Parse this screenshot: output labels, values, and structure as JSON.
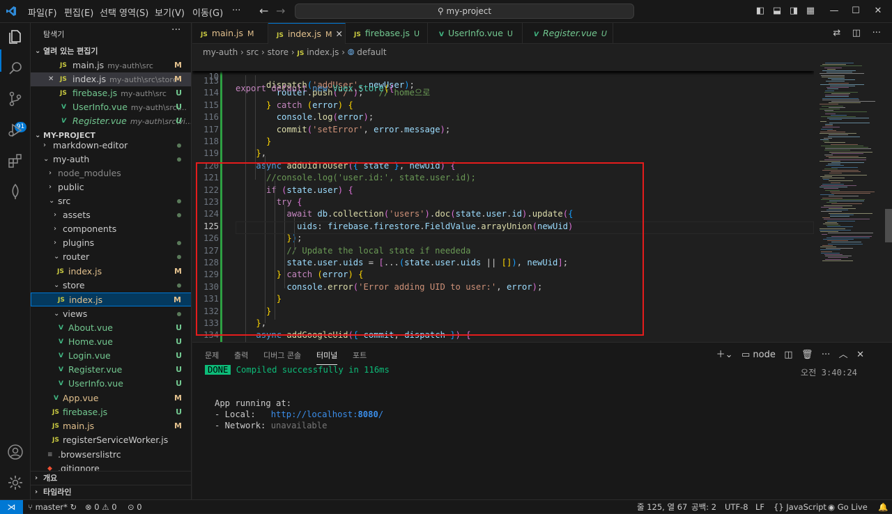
{
  "titlebar": {
    "menu": [
      "파일(F)",
      "편집(E)",
      "선택 영역(S)",
      "보기(V)",
      "이동(G)",
      "···"
    ],
    "search": "my-project"
  },
  "activity": {
    "scm_badge": "91"
  },
  "sidebar": {
    "title": "탐색기",
    "more": "···",
    "open_editors": {
      "header": "열려 있는 편집기",
      "items": [
        {
          "icon": "JS",
          "name": "main.js",
          "path": "my-auth\\src",
          "status": "M"
        },
        {
          "icon": "JS",
          "name": "index.js",
          "path": "my-auth\\src\\store",
          "status": "M"
        },
        {
          "icon": "JS",
          "name": "firebase.js",
          "path": "my-auth\\src",
          "status": "U"
        },
        {
          "icon": "V",
          "name": "UserInfo.vue",
          "path": "my-auth\\src\\...",
          "status": "U"
        },
        {
          "icon": "V",
          "name": "Register.vue",
          "path": "my-auth\\src\\vi...",
          "status": "U"
        }
      ]
    },
    "project": {
      "header": "MY-PROJECT",
      "tree": [
        {
          "name": "markdown-editor",
          "chev": "›"
        },
        {
          "name": "my-auth",
          "chev": "⌄"
        },
        {
          "name": "node_modules",
          "chev": "›"
        },
        {
          "name": "public",
          "chev": "›"
        },
        {
          "name": "src",
          "chev": "⌄"
        },
        {
          "name": "assets",
          "chev": "›"
        },
        {
          "name": "components",
          "chev": "›"
        },
        {
          "name": "plugins",
          "chev": "›"
        },
        {
          "name": "router",
          "chev": "⌄"
        },
        {
          "name": "index.js",
          "icon": "JS",
          "status": "M"
        },
        {
          "name": "store",
          "chev": "⌄"
        },
        {
          "name": "index.js",
          "icon": "JS",
          "status": "M"
        },
        {
          "name": "views",
          "chev": "⌄"
        },
        {
          "name": "About.vue",
          "icon": "V",
          "status": "U"
        },
        {
          "name": "Home.vue",
          "icon": "V",
          "status": "U"
        },
        {
          "name": "Login.vue",
          "icon": "V",
          "status": "U"
        },
        {
          "name": "Register.vue",
          "icon": "V",
          "status": "U"
        },
        {
          "name": "UserInfo.vue",
          "icon": "V",
          "status": "U"
        },
        {
          "name": "App.vue",
          "icon": "V",
          "status": "M"
        },
        {
          "name": "firebase.js",
          "icon": "JS",
          "status": "U"
        },
        {
          "name": "main.js",
          "icon": "JS",
          "status": "M"
        },
        {
          "name": "registerServiceWorker.js",
          "icon": "JS"
        },
        {
          "name": ".browserslistrc",
          "icon": "≡"
        },
        {
          "name": ".gitignore",
          "icon": "◆"
        }
      ]
    },
    "outline": "개요",
    "timeline": "타임라인"
  },
  "tabs": [
    {
      "icon": "JS",
      "label": "main.js",
      "status": "M"
    },
    {
      "icon": "JS",
      "label": "index.js",
      "status": "M"
    },
    {
      "icon": "JS",
      "label": "firebase.js",
      "status": "U"
    },
    {
      "icon": "V",
      "label": "UserInfo.vue",
      "status": "U"
    },
    {
      "icon": "V",
      "label": "Register.vue",
      "status": "U"
    }
  ],
  "breadcrumb": {
    "parts": [
      "my-auth",
      "src",
      "store"
    ],
    "file": "index.js",
    "symbol": "default",
    "sep": "›"
  },
  "code": {
    "sticky_no": "10",
    "sticky": "export default new Vuex.Store({",
    "partial_top": "      dispatch('addUser', newUser);",
    "line_numbers": [
      "113",
      "114",
      "115",
      "116",
      "117",
      "118",
      "119",
      "120",
      "121",
      "122",
      "123",
      "124",
      "125",
      "126",
      "127",
      "128",
      "129",
      "130",
      "131",
      "132",
      "133",
      "134"
    ],
    "lines": [
      "",
      "        router.push(\"/\");   // home으로",
      "      } catch (error) {",
      "        console.log(error);",
      "        commit('setError', error.message);",
      "      }",
      "    },",
      "    async addUidToUser({ state }, newUid) {",
      "      //console.log('user.id:', state.user.id);",
      "      if (state.user) {",
      "        try {",
      "          await db.collection('users').doc(state.user.id).update({",
      "            uids: firebase.firestore.FieldValue.arrayUnion(newUid)",
      "          });",
      "          // Update the local state if neededa",
      "          state.user.uids = [...(state.user.uids || []), newUid];",
      "        } catch (error) {",
      "          console.error('Error adding UID to user:', error);",
      "        }",
      "      }",
      "    },",
      "    async addGoogleUid({ commit, dispatch }) {"
    ]
  },
  "panel": {
    "tabs": [
      "문제",
      "출력",
      "디버그 콘솔",
      "터미널",
      "포트"
    ],
    "terminal_name": "node",
    "time": "오전 3:40:24",
    "done": "DONE",
    "compiled": "Compiled successfully in 116ms",
    "app_running": "App running at:",
    "local_label": "- Local:   ",
    "local_url": "http://localhost:",
    "local_port": "8080",
    "local_tail": "/",
    "network_label": "- Network: ",
    "network_value": "unavailable"
  },
  "statusbar": {
    "branch": "master*",
    "errors": "0",
    "warnings": "0",
    "ports": "0",
    "position": "줄 125, 열 67",
    "spaces": "공백: 2",
    "encoding": "UTF-8",
    "eol": "LF",
    "language": "JavaScript",
    "golive": "Go Live"
  }
}
